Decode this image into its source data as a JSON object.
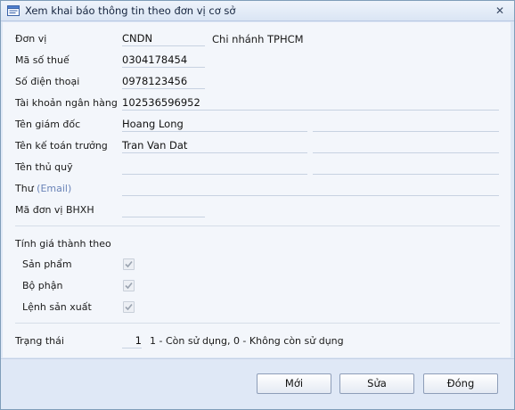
{
  "window": {
    "title": "Xem khai báo thông tin theo đơn vị cơ sở",
    "close_glyph": "✕"
  },
  "form": {
    "don_vi": {
      "label": "Đơn vị",
      "code": "CNDN",
      "name": "Chi nhánh TPHCM"
    },
    "ma_so_thue": {
      "label": "Mã số thuế",
      "value": "0304178454"
    },
    "so_dien_thoai": {
      "label": "Số điện thoại",
      "value": "0978123456"
    },
    "tai_khoan": {
      "label": "Tài khoản ngân hàng",
      "value": "102536596952"
    },
    "giam_doc": {
      "label": "Tên giám đốc",
      "value": "Hoang Long"
    },
    "ke_toan_truong": {
      "label": "Tên kế toán trưởng",
      "value": "Tran Van Dat"
    },
    "thu_quy": {
      "label": "Tên thủ quỹ",
      "value": ""
    },
    "email": {
      "label": "Thư",
      "hint": "(Email)",
      "value": ""
    },
    "bhxh": {
      "label": "Mã đơn vị BHXH",
      "value": ""
    }
  },
  "costing": {
    "heading": "Tính giá thành theo",
    "options": [
      {
        "label": "Sản phẩm",
        "checked": true
      },
      {
        "label": "Bộ phận",
        "checked": true
      },
      {
        "label": "Lệnh sản xuất",
        "checked": true
      }
    ]
  },
  "status": {
    "label": "Trạng thái",
    "value": "1",
    "hint": "1 - Còn sử dụng, 0 - Không còn sử dụng"
  },
  "buttons": {
    "new": "Mới",
    "edit": "Sửa",
    "close": "Đóng"
  }
}
